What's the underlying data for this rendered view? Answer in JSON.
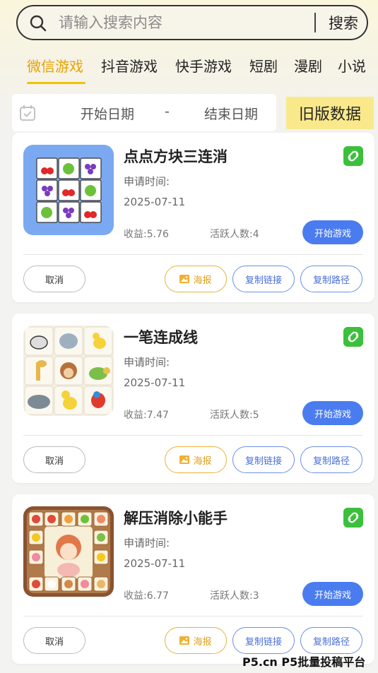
{
  "search": {
    "placeholder": "请输入搜索内容",
    "button_label": "搜索"
  },
  "tabs": [
    {
      "label": "微信游戏",
      "active": true
    },
    {
      "label": "抖音游戏",
      "active": false
    },
    {
      "label": "快手游戏",
      "active": false
    },
    {
      "label": "短剧",
      "active": false
    },
    {
      "label": "漫剧",
      "active": false
    },
    {
      "label": "小说",
      "active": false
    }
  ],
  "date_filter": {
    "start_placeholder": "开始日期",
    "separator": "-",
    "end_placeholder": "结束日期"
  },
  "old_data_button": "旧版数据",
  "games": [
    {
      "title": "点点方块三连消",
      "apply_label": "申请时间:",
      "apply_date": "2025-07-11",
      "income": "收益:5.76",
      "active_users": "活跃人数:4",
      "start_label": "开始游戏",
      "cancel_label": "取消",
      "poster_label": "海报",
      "copy_link_label": "复制链接",
      "copy_path_label": "复制路径"
    },
    {
      "title": "一笔连成线",
      "apply_label": "申请时间:",
      "apply_date": "2025-07-11",
      "income": "收益:7.47",
      "active_users": "活跃人数:5",
      "start_label": "开始游戏",
      "cancel_label": "取消",
      "poster_label": "海报",
      "copy_link_label": "复制链接",
      "copy_path_label": "复制路径"
    },
    {
      "title": "解压消除小能手",
      "apply_label": "申请时间:",
      "apply_date": "2025-07-11",
      "income": "收益:6.77",
      "active_users": "活跃人数:3",
      "start_label": "开始游戏",
      "cancel_label": "取消",
      "poster_label": "海报",
      "copy_link_label": "复制链接",
      "copy_path_label": "复制路径"
    }
  ],
  "watermark": "P5.cn P5批量投稿平台",
  "colors": {
    "accent_active_tab": "#e8a200",
    "primary_button": "#4a7cf0",
    "old_data_bg": "#fae98b",
    "link_badge": "#3cc03c",
    "poster_border": "#e8b23a"
  },
  "icons": [
    "search-icon",
    "calendar-icon",
    "mini-program-link-icon",
    "image-icon"
  ]
}
